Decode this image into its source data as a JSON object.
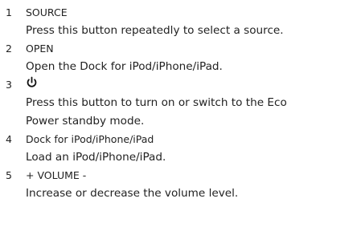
{
  "items": [
    {
      "number": "1",
      "label": "SOURCE",
      "description": [
        "Press this button repeatedly to select a source."
      ]
    },
    {
      "number": "2",
      "label": "OPEN",
      "description": [
        "Open the Dock for iPod/iPhone/iPad."
      ]
    },
    {
      "number": "3",
      "label_icon": "power-icon",
      "description": [
        "Press this button to turn on or switch to the Eco",
        "Power standby mode."
      ]
    },
    {
      "number": "4",
      "label": "Dock for iPod/iPhone/iPad",
      "description": [
        "Load an iPod/iPhone/iPad."
      ]
    },
    {
      "number": "5",
      "label": "+ VOLUME -",
      "description": [
        "Increase or decrease the volume level."
      ]
    }
  ]
}
